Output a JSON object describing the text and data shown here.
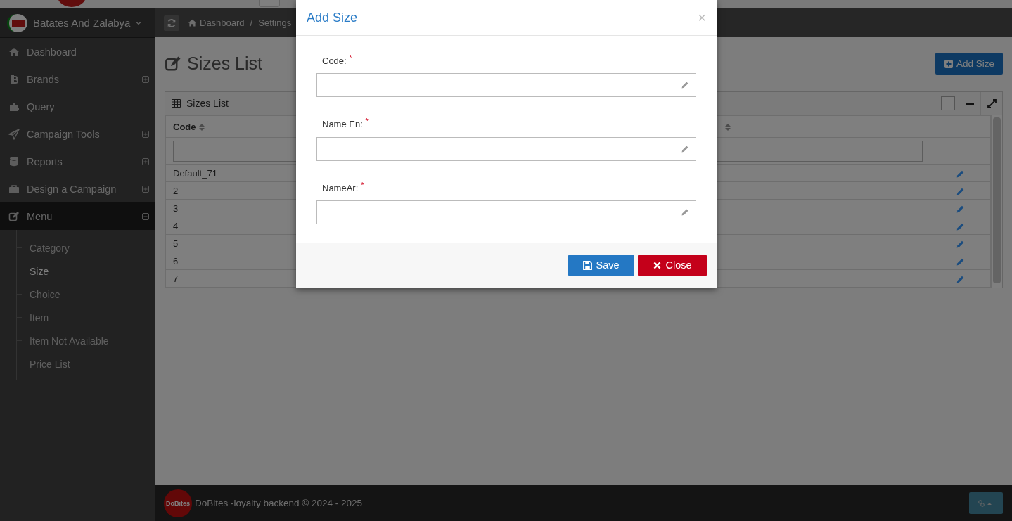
{
  "brand": {
    "name": "Batates And Zalabya"
  },
  "breadcrumb": {
    "items": [
      "Dashboard",
      "Settings"
    ],
    "separator": "/"
  },
  "sidebar": {
    "items": [
      {
        "label": "Dashboard"
      },
      {
        "label": "Brands",
        "expanded": false
      },
      {
        "label": "Query"
      },
      {
        "label": "Campaign Tools",
        "expanded": false
      },
      {
        "label": "Reports",
        "expanded": false
      },
      {
        "label": "Design a Campaign",
        "expanded": false
      },
      {
        "label": "Menu",
        "expanded": true,
        "children": [
          {
            "label": "Category",
            "selected": false
          },
          {
            "label": "Size",
            "selected": true
          },
          {
            "label": "Choice",
            "selected": false
          },
          {
            "label": "Item",
            "selected": false
          },
          {
            "label": "Item Not Available",
            "selected": false
          },
          {
            "label": "Price List",
            "selected": false
          }
        ]
      }
    ]
  },
  "page": {
    "title": "Sizes List",
    "add_button": "Add Size"
  },
  "panel": {
    "title": "Sizes List",
    "checkbox_checked": false,
    "columns": [
      "Code",
      "",
      ""
    ],
    "rows": [
      {
        "code": "Default_71"
      },
      {
        "code": "2"
      },
      {
        "code": "3"
      },
      {
        "code": "4"
      },
      {
        "code": "5"
      },
      {
        "code": "6"
      },
      {
        "code": "7"
      }
    ]
  },
  "modal": {
    "title": "Add Size",
    "close": "×",
    "fields": [
      {
        "label": "Code:",
        "required_mark": "*"
      },
      {
        "label": "Name En:",
        "required_mark": "*"
      },
      {
        "label": "NameAr:",
        "required_mark": "*"
      }
    ],
    "buttons": [
      {
        "label": "Save",
        "kind": "save"
      },
      {
        "label": "Close",
        "kind": "close"
      }
    ]
  },
  "footer": {
    "text": "DoBites -loyalty backend © 2024 - 2025",
    "logo": "DoBites"
  }
}
